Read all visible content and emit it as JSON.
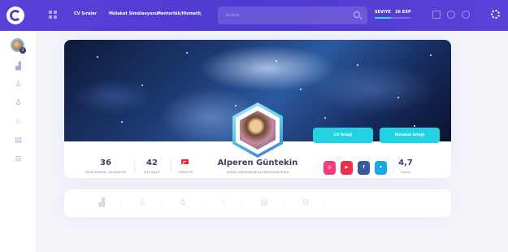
{
  "topbar": {
    "nav": [
      "CV Sıralar",
      "Mülakat Simülasyonu",
      "Mentorlük/Hizmetli"
    ],
    "search_placeholder": "Arama",
    "level_label": "SEVIYE",
    "xp_label": "36 EXP",
    "level_progress": 0.45
  },
  "profile": {
    "name": "Alperen Güntekin",
    "subtitle": "WWW.LINKEDIN/IN/ALPERENGUNTEKIN",
    "stats": {
      "views": {
        "value": "36",
        "label": "WEBLERDEN İZLENDİNE"
      },
      "interviews": {
        "value": "42",
        "label": "MÜLAKAT"
      },
      "country": {
        "label": "TÜRKİYE"
      }
    },
    "rating": {
      "value": "4,7",
      "label": "PUAN"
    },
    "buttons": {
      "cv_request": "CV İsteği",
      "interview_request": "Mülakat İsteği"
    },
    "socials": [
      {
        "name": "instagram",
        "glyph": "◎",
        "color": "#f13d7a"
      },
      {
        "name": "youtube",
        "glyph": "▶",
        "color": "#ee2d4a"
      },
      {
        "name": "facebook",
        "glyph": "f",
        "color": "#3b5998"
      },
      {
        "name": "twitter",
        "glyph": "✦",
        "color": "#1ba9e6"
      }
    ]
  },
  "sidebar": {
    "badge": "3",
    "icons": [
      "chart-icon",
      "user-icon",
      "badge-icon",
      "star-icon",
      "calendar-icon",
      "store-icon"
    ]
  },
  "tabs": {
    "icons": [
      "chart-icon",
      "user-icon",
      "badge-icon",
      "star-icon",
      "calendar-icon",
      "store-icon"
    ]
  },
  "colors": {
    "topbar": "#5b3fd9",
    "accent_cyan": "#23d2e2",
    "text_dark": "#3e3f5e",
    "text_muted": "#adafca"
  }
}
